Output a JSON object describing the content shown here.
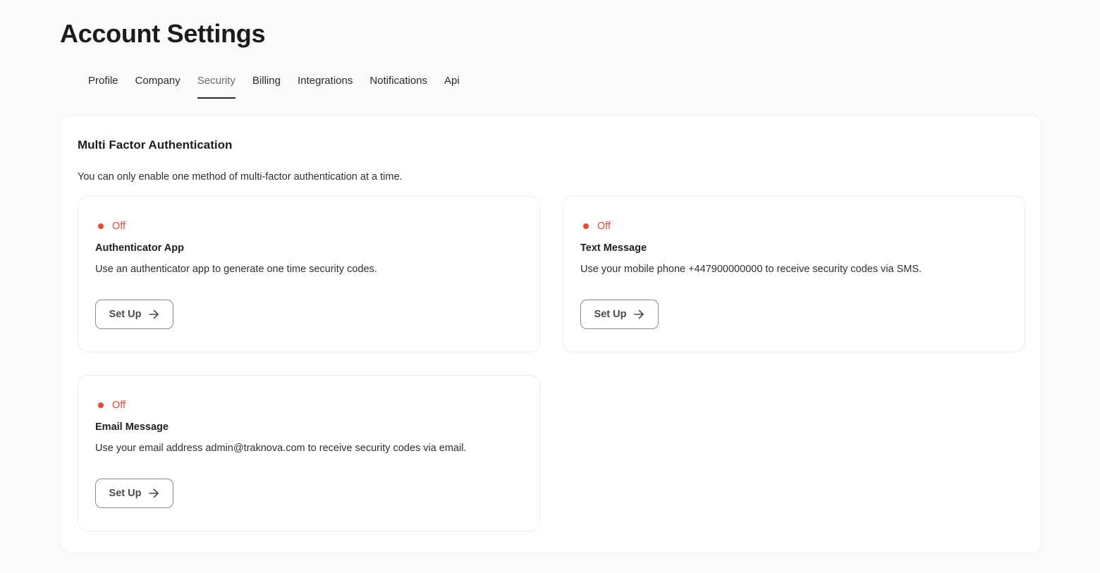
{
  "page": {
    "title": "Account Settings"
  },
  "tabs": [
    {
      "label": "Profile",
      "active": false
    },
    {
      "label": "Company",
      "active": false
    },
    {
      "label": "Security",
      "active": true
    },
    {
      "label": "Billing",
      "active": false
    },
    {
      "label": "Integrations",
      "active": false
    },
    {
      "label": "Notifications",
      "active": false
    },
    {
      "label": "Api",
      "active": false
    }
  ],
  "mfa": {
    "title": "Multi Factor Authentication",
    "description": "You can only enable one method of multi-factor authentication at a time.",
    "methods": [
      {
        "status": "Off",
        "title": "Authenticator App",
        "description": "Use an authenticator app to generate one time security codes.",
        "button_label": "Set Up"
      },
      {
        "status": "Off",
        "title": "Text Message",
        "description": "Use your mobile phone +447900000000 to receive security codes via SMS.",
        "button_label": "Set Up"
      },
      {
        "status": "Off",
        "title": "Email Message",
        "description": "Use your email address admin@traknova.com to receive security codes via email.",
        "button_label": "Set Up"
      }
    ]
  },
  "colors": {
    "status_off": "#e04a3a",
    "active_tab_underline": "#2b2b2b",
    "background": "#fafafa",
    "card": "#ffffff"
  },
  "icons": {
    "setup_button": "arrow-right-icon",
    "status": "status-dot-icon"
  }
}
